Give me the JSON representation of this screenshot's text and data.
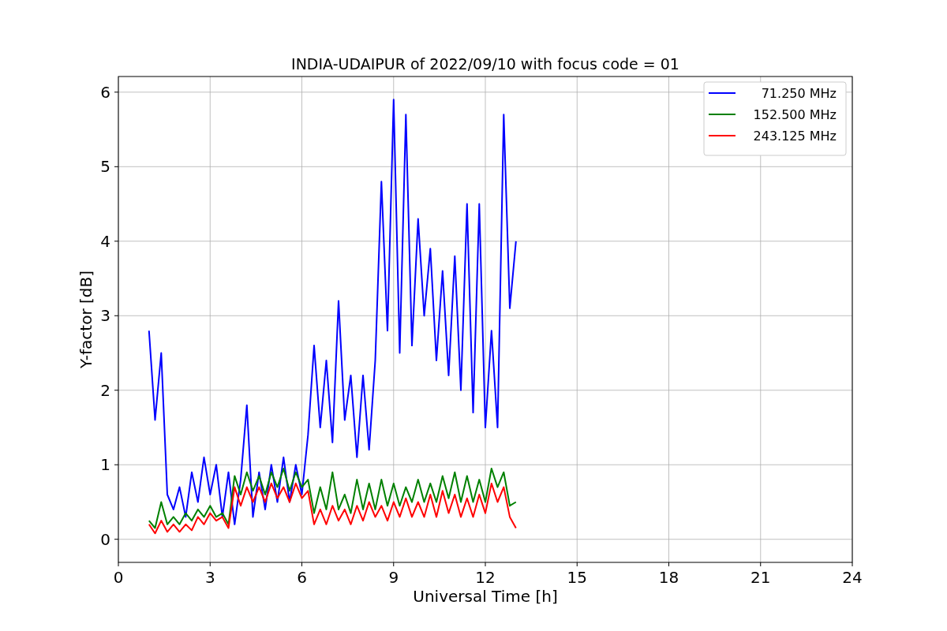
{
  "chart_data": {
    "type": "line",
    "title": "INDIA-UDAIPUR of 2022/09/10 with focus code = 01",
    "xlabel": "Universal Time [h]",
    "ylabel": "Y-factor [dB]",
    "x": [
      1.0,
      1.2,
      1.4,
      1.6,
      1.8,
      2.0,
      2.2,
      2.4,
      2.6,
      2.8,
      3.0,
      3.2,
      3.4,
      3.6,
      3.8,
      4.0,
      4.2,
      4.4,
      4.6,
      4.8,
      5.0,
      5.2,
      5.4,
      5.6,
      5.8,
      6.0,
      6.2,
      6.4,
      6.6,
      6.8,
      7.0,
      7.2,
      7.4,
      7.6,
      7.8,
      8.0,
      8.2,
      8.4,
      8.6,
      8.8,
      9.0,
      9.2,
      9.4,
      9.6,
      9.8,
      10.0,
      10.2,
      10.4,
      10.6,
      10.8,
      11.0,
      11.2,
      11.4,
      11.6,
      11.8,
      12.0,
      12.2,
      12.4,
      12.6,
      12.8,
      13.0
    ],
    "series": [
      {
        "name": "71.250 MHz",
        "color": "#0000ff",
        "values": [
          2.8,
          1.6,
          2.5,
          0.6,
          0.4,
          0.7,
          0.3,
          0.9,
          0.5,
          1.1,
          0.6,
          1.0,
          0.3,
          0.9,
          0.2,
          0.8,
          1.8,
          0.3,
          0.9,
          0.4,
          1.0,
          0.5,
          1.1,
          0.5,
          1.0,
          0.6,
          1.4,
          2.6,
          1.5,
          2.4,
          1.3,
          3.2,
          1.6,
          2.2,
          1.1,
          2.2,
          1.2,
          2.4,
          4.8,
          2.8,
          5.9,
          2.5,
          5.7,
          2.6,
          4.3,
          3.0,
          3.9,
          2.4,
          3.6,
          2.2,
          3.8,
          2.0,
          4.5,
          1.7,
          4.5,
          1.5,
          2.8,
          1.5,
          5.7,
          3.1,
          4.0
        ]
      },
      {
        "name": "152.500 MHz",
        "color": "#008000",
        "values": [
          0.25,
          0.15,
          0.5,
          0.2,
          0.3,
          0.2,
          0.35,
          0.25,
          0.4,
          0.3,
          0.45,
          0.3,
          0.35,
          0.2,
          0.85,
          0.6,
          0.9,
          0.65,
          0.85,
          0.6,
          0.9,
          0.7,
          0.95,
          0.65,
          0.9,
          0.7,
          0.8,
          0.35,
          0.7,
          0.4,
          0.9,
          0.4,
          0.6,
          0.35,
          0.8,
          0.4,
          0.75,
          0.4,
          0.8,
          0.45,
          0.75,
          0.45,
          0.7,
          0.5,
          0.8,
          0.5,
          0.75,
          0.5,
          0.85,
          0.55,
          0.9,
          0.5,
          0.85,
          0.5,
          0.8,
          0.5,
          0.95,
          0.7,
          0.9,
          0.45,
          0.5
        ]
      },
      {
        "name": "243.125 MHz",
        "color": "#ff0000",
        "values": [
          0.2,
          0.08,
          0.25,
          0.1,
          0.2,
          0.1,
          0.2,
          0.12,
          0.3,
          0.2,
          0.35,
          0.25,
          0.3,
          0.15,
          0.7,
          0.45,
          0.7,
          0.5,
          0.7,
          0.5,
          0.75,
          0.55,
          0.7,
          0.5,
          0.75,
          0.55,
          0.65,
          0.2,
          0.4,
          0.2,
          0.45,
          0.25,
          0.4,
          0.2,
          0.45,
          0.25,
          0.5,
          0.3,
          0.45,
          0.25,
          0.5,
          0.3,
          0.55,
          0.3,
          0.5,
          0.3,
          0.6,
          0.3,
          0.65,
          0.35,
          0.6,
          0.3,
          0.55,
          0.3,
          0.6,
          0.35,
          0.75,
          0.5,
          0.7,
          0.3,
          0.15
        ]
      }
    ],
    "xlim": [
      0,
      24
    ],
    "ylim": [
      -0.31,
      6.21
    ],
    "xticks": [
      0,
      3,
      6,
      9,
      12,
      15,
      18,
      21,
      24
    ],
    "yticks": [
      0,
      1,
      2,
      3,
      4,
      5,
      6
    ],
    "grid": true,
    "legend": "upper right"
  }
}
